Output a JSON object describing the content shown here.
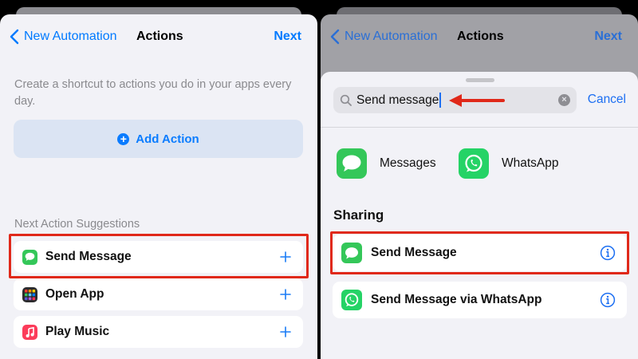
{
  "left": {
    "nav": {
      "back_label": "New Automation",
      "title": "Actions",
      "next_label": "Next"
    },
    "helper_text": "Create a shortcut to actions you do in your apps every day.",
    "add_action_label": "Add Action",
    "suggestions_header": "Next Action Suggestions",
    "suggestions": [
      {
        "label": "Send Message",
        "icon": "messages-icon"
      },
      {
        "label": "Open App",
        "icon": "open-app-icon"
      },
      {
        "label": "Play Music",
        "icon": "music-icon"
      }
    ],
    "highlighted_suggestion": "Send Message"
  },
  "right": {
    "nav": {
      "back_label": "New Automation",
      "title": "Actions",
      "next_label": "Next"
    },
    "search": {
      "value": "Send message",
      "cancel_label": "Cancel"
    },
    "apps": [
      {
        "label": "Messages",
        "icon": "messages-icon"
      },
      {
        "label": "WhatsApp",
        "icon": "whatsapp-icon"
      }
    ],
    "section_header": "Sharing",
    "results": [
      {
        "label": "Send Message",
        "icon": "messages-icon"
      },
      {
        "label": "Send Message via WhatsApp",
        "icon": "whatsapp-icon"
      }
    ]
  },
  "colors": {
    "ios_blue": "#007aff",
    "highlight_red": "#e0291a",
    "messages_green": "#34c759",
    "whatsapp_green": "#25d366",
    "background": "#f2f2f7"
  }
}
